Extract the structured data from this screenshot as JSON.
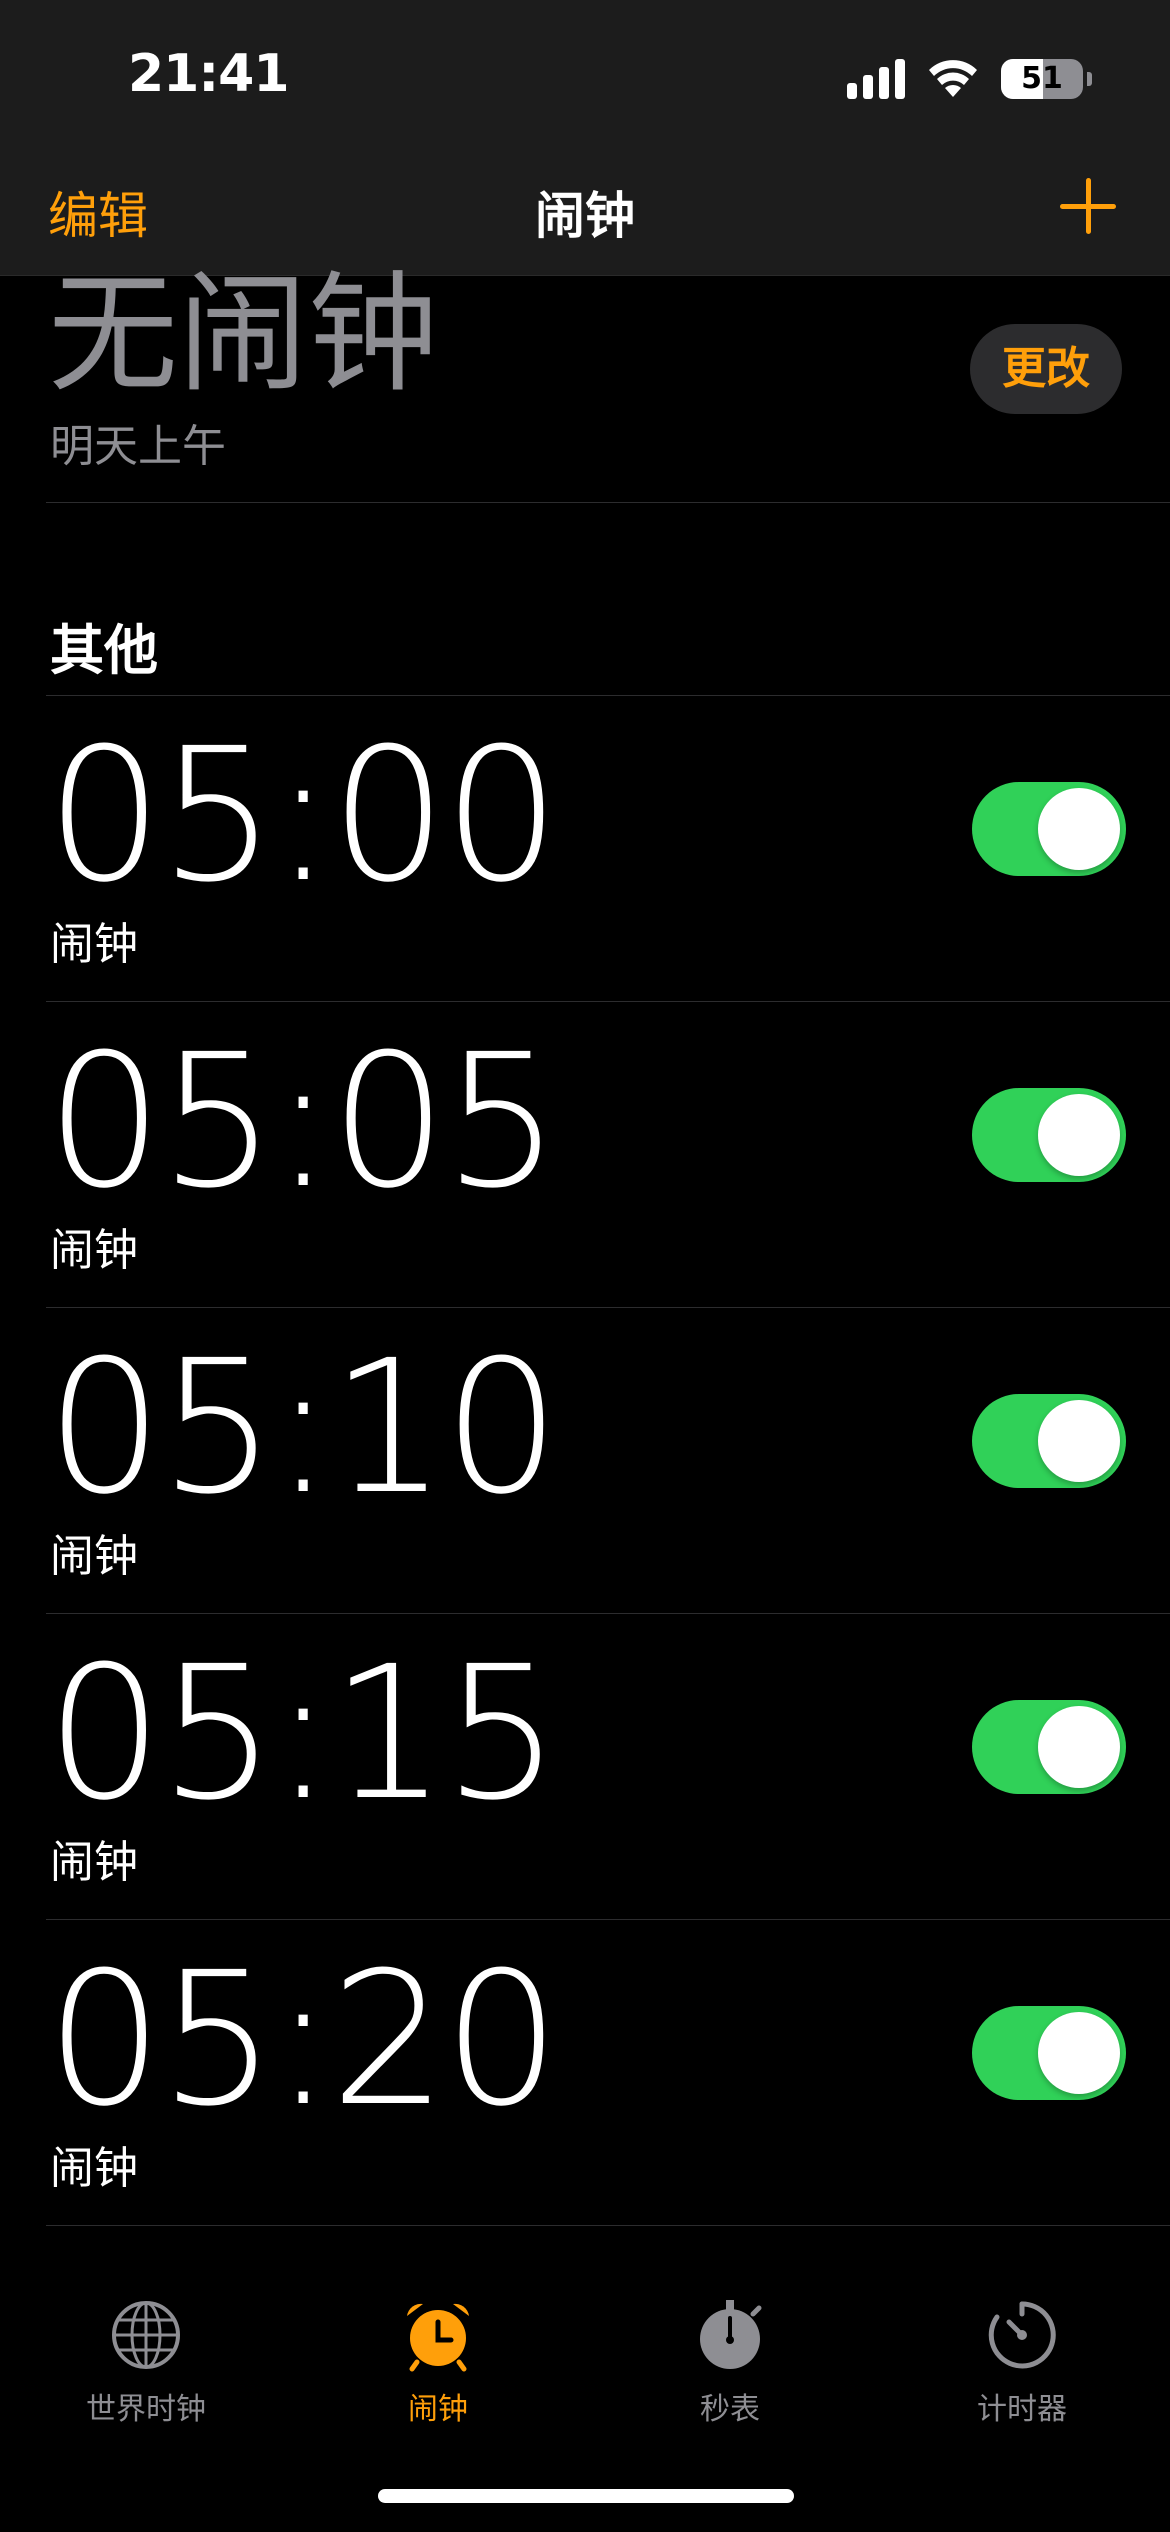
{
  "status_bar": {
    "time": "21:41",
    "battery_level": "51"
  },
  "nav": {
    "edit": "编辑",
    "title": "闹钟",
    "add_icon": "plus-icon"
  },
  "sleep": {
    "status": "无闹钟",
    "subtitle": "明天上午",
    "change_label": "更改"
  },
  "section": {
    "title": "其他"
  },
  "alarms": [
    {
      "time": "05:00",
      "label": "闹钟",
      "enabled": true
    },
    {
      "time": "05:05",
      "label": "闹钟",
      "enabled": true
    },
    {
      "time": "05:10",
      "label": "闹钟",
      "enabled": true
    },
    {
      "time": "05:15",
      "label": "闹钟",
      "enabled": true
    },
    {
      "time": "05:20",
      "label": "闹钟",
      "enabled": true
    }
  ],
  "tabs": [
    {
      "label": "世界时钟",
      "icon": "globe-icon",
      "active": false
    },
    {
      "label": "闹钟",
      "icon": "alarm-clock-icon",
      "active": true
    },
    {
      "label": "秒表",
      "icon": "stopwatch-icon",
      "active": false
    },
    {
      "label": "计时器",
      "icon": "timer-icon",
      "active": false
    }
  ],
  "colors": {
    "accent": "#ff9f0a",
    "toggle_on": "#30d158",
    "secondary_text": "#8e8e93"
  }
}
